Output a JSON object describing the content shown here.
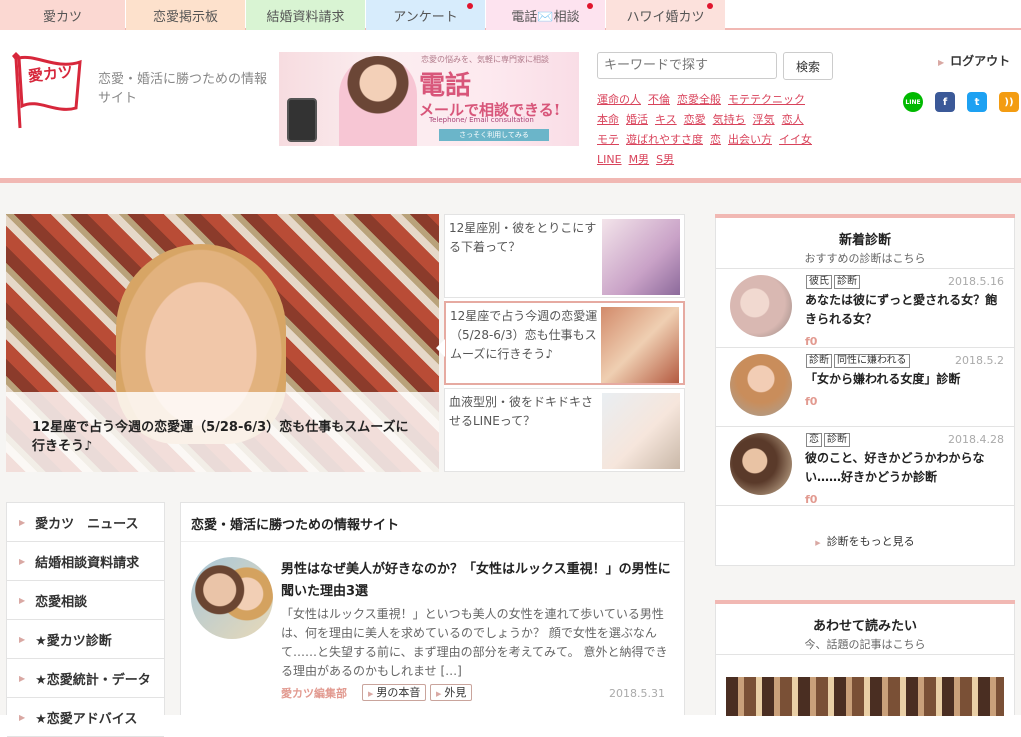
{
  "tabs": [
    {
      "label": "愛カツ",
      "color": "#fbd8d2",
      "width": 125,
      "dot": false
    },
    {
      "label": "恋愛掲示板",
      "color": "#fde1cc",
      "width": 119,
      "dot": false
    },
    {
      "label": "結婚資料請求",
      "color": "#d9f4d3",
      "width": 119,
      "dot": false
    },
    {
      "label": "アンケート",
      "color": "#d7ecfc",
      "width": 119,
      "dot": true
    },
    {
      "label": "電話✉️相談",
      "color": "#fde3ef",
      "width": 119,
      "dot": true
    },
    {
      "label": "ハワイ婚カツ",
      "color": "#fce1dc",
      "width": 119,
      "dot": true
    }
  ],
  "header": {
    "tagline": "恋愛・婚活に勝つための情報サイト",
    "logo_text": "愛カツ",
    "banner": {
      "subtitle": "恋愛の悩みを、気軽に専門家に相談",
      "title_line1": "電話",
      "title_line2": "メールで相談できる!",
      "caption": "Telephone/ Email consultation",
      "button": "さっそく利用してみる"
    },
    "search_placeholder": "キーワードで探す",
    "search_button": "検索",
    "logout": "ログアウト",
    "keywords": [
      "運命の人",
      "不倫",
      "恋愛全般",
      "モテテクニック",
      "本命",
      "婚活",
      "キス",
      "恋愛",
      "気持ち",
      "浮気",
      "恋人",
      "モテ",
      "遊ばれやすさ度",
      "恋",
      "出会い方",
      "イイ女",
      "LINE",
      "M男",
      "S男"
    ],
    "social": [
      {
        "name": "line-icon",
        "glyph": "LINE",
        "color": "#00b900"
      },
      {
        "name": "facebook-icon",
        "glyph": "f",
        "color": "#3b5998"
      },
      {
        "name": "twitter-icon",
        "glyph": "t",
        "color": "#1da1f2"
      },
      {
        "name": "rss-icon",
        "glyph": "))",
        "color": "#f39c12"
      }
    ]
  },
  "hero": {
    "caption": "12星座で占う今週の恋愛運（5/28-6/3）恋も仕事もスムーズに行きそう♪"
  },
  "side_list": [
    {
      "title": "12星座別・彼をとりこにする下着って？",
      "active": false
    },
    {
      "title": "12星座で占う今週の恋愛運（5/28-6/3）恋も仕事もスムーズに行きそう♪",
      "active": true
    },
    {
      "title": "血液型別・彼をドキドキさせるLINEって？",
      "active": false
    }
  ],
  "nav": [
    "愛カツ　ニュース",
    "結婚相談資料請求",
    "恋愛相談",
    "★愛カツ診断",
    "★恋愛統計・データ",
    "★恋愛アドバイス"
  ],
  "main": {
    "title": "恋愛・婚活に勝つための情報サイト",
    "article": {
      "title": "男性はなぜ美人が好きなのか？「女性はルックス重視！」の男性に聞いた理由3選",
      "body": "「女性はルックス重視！」といつも美人の女性を連れて歩いている男性は、何を理由に美人を求めているのでしょうか？ 顔で女性を選ぶなんて……と失望する前に、まず理由の部分を考えてみて。 意外と納得できる理由があるのかもしれませ […]",
      "author": "愛カツ編集部",
      "tags": [
        "男の本音",
        "外見"
      ],
      "date": "2018.5.31"
    }
  },
  "diagnosis": {
    "heading": "新着診断",
    "subheading": "おすすめの診断はこちら",
    "items": [
      {
        "tags": [
          "彼氏",
          "診断"
        ],
        "date": "2018.5.16",
        "title": "あなたは彼にずっと愛される女？飽きられる女？",
        "likes": "0"
      },
      {
        "tags": [
          "診断",
          "同性に嫌われる"
        ],
        "date": "2018.5.2",
        "title": "「女から嫌われる女度」診断",
        "likes": "0"
      },
      {
        "tags": [
          "恋",
          "診断"
        ],
        "date": "2018.4.28",
        "title": "彼のこと、好きかどうかわからない……好きかどうか診断",
        "likes": "0"
      }
    ],
    "more": "診断をもっと見る"
  },
  "also": {
    "heading": "あわせて読みたい",
    "subheading": "今、話題の記事はこちら"
  }
}
